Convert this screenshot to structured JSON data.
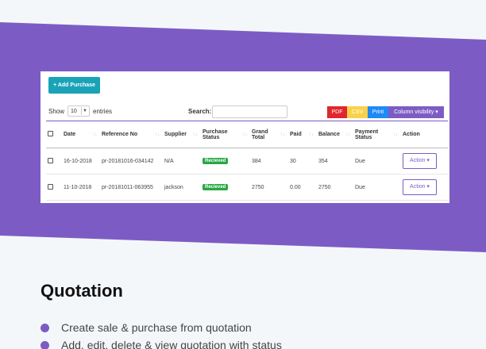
{
  "colors": {
    "band": "#7c5cc4",
    "add_button": "#1aa3b8",
    "pdf": "#e0262e",
    "csv": "#f9d248",
    "print": "#1e8af5",
    "column_visibility": "#7c5cc4",
    "status_badge": "#28a745"
  },
  "toolbar": {
    "add_purchase_label": "+ Add Purchase",
    "show_label": "Show",
    "page_size": "10",
    "entries_label": "entries",
    "search_label": "Search:",
    "search_value": "",
    "pdf_label": "PDF",
    "csv_label": "CSV",
    "print_label": "Print",
    "column_visibility_label": "Column visibility ▾"
  },
  "table": {
    "headers": {
      "date": "Date",
      "reference": "Reference No",
      "supplier": "Supplier",
      "purchase_status_1": "Purchase",
      "purchase_status_2": "Status",
      "grand_total_1": "Grand",
      "grand_total_2": "Total",
      "paid": "Paid",
      "balance": "Balance",
      "payment_status_1": "Payment",
      "payment_status_2": "Status",
      "action": "Action"
    },
    "rows": [
      {
        "date": "16-10-2018",
        "reference": "pr-20181016-034142",
        "supplier": "N/A",
        "status": "Recieved",
        "grand_total": "384",
        "paid": "30",
        "balance": "354",
        "payment_status": "Due",
        "action": "Action ▾"
      },
      {
        "date": "11-10-2018",
        "reference": "pr-20181011-063955",
        "supplier": "jackson",
        "status": "Recieved",
        "grand_total": "2750",
        "paid": "0.00",
        "balance": "2750",
        "payment_status": "Due",
        "action": "Action ▾"
      }
    ]
  },
  "section": {
    "title": "Quotation",
    "features": [
      "Create sale & purchase from quotation",
      "Add, edit, delete & view quotation with status"
    ]
  }
}
